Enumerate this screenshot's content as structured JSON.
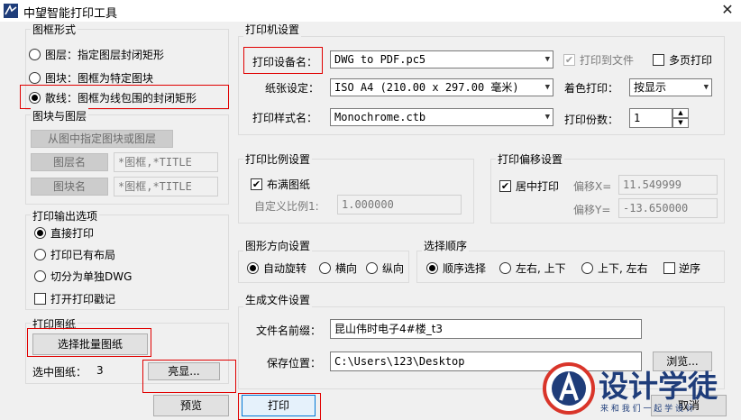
{
  "window": {
    "title": "中望智能打印工具",
    "close_icon": "close-icon"
  },
  "frame_form": {
    "title": "图框形式",
    "options": [
      "图层：指定图层封闭矩形",
      "图块：图框为特定图块",
      "散线：图框为线包围的封闭矩形"
    ],
    "selected_index": 2
  },
  "block_layer": {
    "title": "图块与图层",
    "pick_button": "从图中指定图块或图层",
    "layer_button": "图层名",
    "layer_value": "*图框,*TITLE",
    "block_button": "图块名",
    "block_value": "*图框,*TITLE"
  },
  "output": {
    "title": "打印输出选项",
    "options": [
      "直接打印",
      "打印已有布局",
      "切分为单独DWG"
    ],
    "selected_index": 0,
    "stamp_label": "打开打印戳记",
    "stamp_checked": false
  },
  "drawings": {
    "title": "打印图纸",
    "select_button": "选择批量图纸",
    "selected_label": "选中图纸：",
    "selected_count": "3",
    "highlight_button": "亮显..."
  },
  "printer": {
    "title": "打印机设置",
    "device_label": "打印设备名：",
    "device_value": "DWG to PDF.pc5",
    "print_to_file_label": "打印到文件",
    "print_to_file_checked": true,
    "multi_page_label": "多页打印",
    "multi_page_checked": false,
    "paper_label": "纸张设定：",
    "paper_value": "ISO A4 (210.00 x 297.00 毫米)",
    "color_label": "着色打印：",
    "color_value": "按显示",
    "style_label": "打印样式名：",
    "style_value": "Monochrome.ctb",
    "copies_label": "打印份数：",
    "copies_value": "1"
  },
  "scale": {
    "title": "打印比例设置",
    "fit_label": "布满图纸",
    "fit_checked": true,
    "custom_label": "自定义比例1:",
    "custom_value": "1.000000"
  },
  "offset": {
    "title": "打印偏移设置",
    "center_label": "居中打印",
    "center_checked": true,
    "x_label": "偏移X=",
    "x_value": "11.549999",
    "y_label": "偏移Y=",
    "y_value": "-13.650000"
  },
  "orientation": {
    "title": "图形方向设置",
    "options": [
      "自动旋转",
      "横向",
      "纵向"
    ],
    "selected_index": 0
  },
  "order": {
    "title": "选择顺序",
    "options": [
      "顺序选择",
      "左右, 上下",
      "上下, 左右"
    ],
    "selected_index": 0,
    "reverse_label": "逆序",
    "reverse_checked": false
  },
  "file": {
    "title": "生成文件设置",
    "prefix_label": "文件名前缀：",
    "prefix_value": "昆山伟时电子4#楼_t3",
    "path_label": "保存位置：",
    "path_value": "C:\\Users\\123\\Desktop",
    "browse_button": "浏览..."
  },
  "buttons": {
    "preview": "预览",
    "print": "打印",
    "cancel": "取消"
  },
  "watermark": {
    "brand": "设计学徒",
    "slogan": "来 和 我 们 一 起 学 设 计"
  }
}
